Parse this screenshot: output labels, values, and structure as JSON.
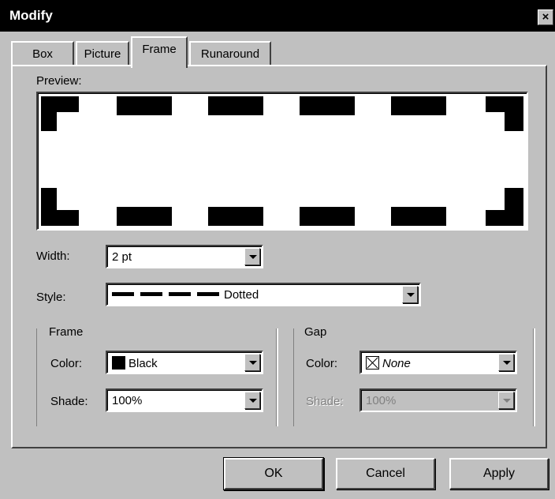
{
  "window": {
    "title": "Modify",
    "close_glyph": "×"
  },
  "tabs": [
    {
      "label": "Box",
      "active": false
    },
    {
      "label": "Picture",
      "active": false
    },
    {
      "label": "Frame",
      "active": true
    },
    {
      "label": "Runaround",
      "active": false
    }
  ],
  "preview": {
    "label": "Preview:",
    "frame_style": "dashed"
  },
  "width": {
    "label": "Width:",
    "value": "2 pt"
  },
  "style": {
    "label": "Style:",
    "value": "Dotted"
  },
  "frame": {
    "heading": "Frame",
    "color_label": "Color:",
    "color_value": "Black",
    "color_icon": "black-swatch-icon",
    "shade_label": "Shade:",
    "shade_value": "100%"
  },
  "gap": {
    "heading": "Gap",
    "color_label": "Color:",
    "color_value": "None",
    "color_icon": "none-swatch-icon",
    "shade_label": "Shade:",
    "shade_value": "100%",
    "shade_disabled": true
  },
  "buttons": {
    "ok": "OK",
    "cancel": "Cancel",
    "apply": "Apply"
  },
  "colors": {
    "face": "#c0c0c0",
    "titlebar": "#000000",
    "field": "#ffffff"
  }
}
